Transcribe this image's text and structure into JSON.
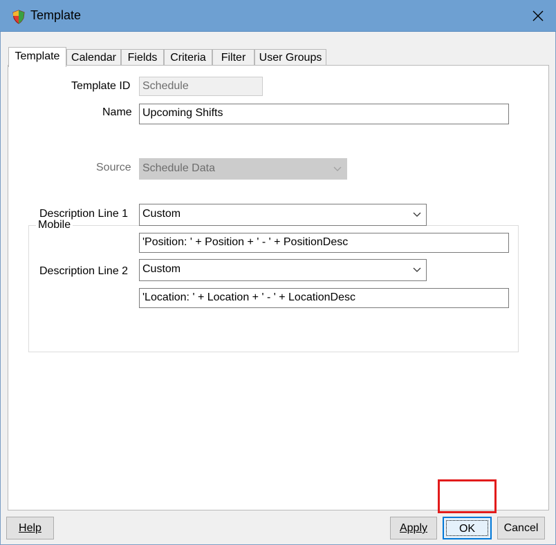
{
  "window": {
    "title": "Template"
  },
  "tabs": [
    {
      "label": "Template"
    },
    {
      "label": "Calendar"
    },
    {
      "label": "Fields"
    },
    {
      "label": "Criteria"
    },
    {
      "label": "Filter"
    },
    {
      "label": "User Groups"
    }
  ],
  "form": {
    "template_id_label": "Template ID",
    "template_id_value": "Schedule",
    "name_label": "Name",
    "name_value": "Upcoming Shifts",
    "source_label": "Source",
    "source_value": "Schedule Data"
  },
  "mobile": {
    "group_label": "Mobile",
    "line1_label": "Description Line 1",
    "line1_select": "Custom",
    "line1_expression": "'Position: ' + Position + ' - ' + PositionDesc",
    "line2_label": "Description Line 2",
    "line2_select": "Custom",
    "line2_expression": "'Location: ' + Location + ' - ' + LocationDesc"
  },
  "buttons": {
    "help": "Help",
    "apply": "Apply",
    "ok": "OK",
    "cancel": "Cancel"
  },
  "colors": {
    "titlebar": "#6ea0d2",
    "focus_highlight": "#e21b1b"
  }
}
